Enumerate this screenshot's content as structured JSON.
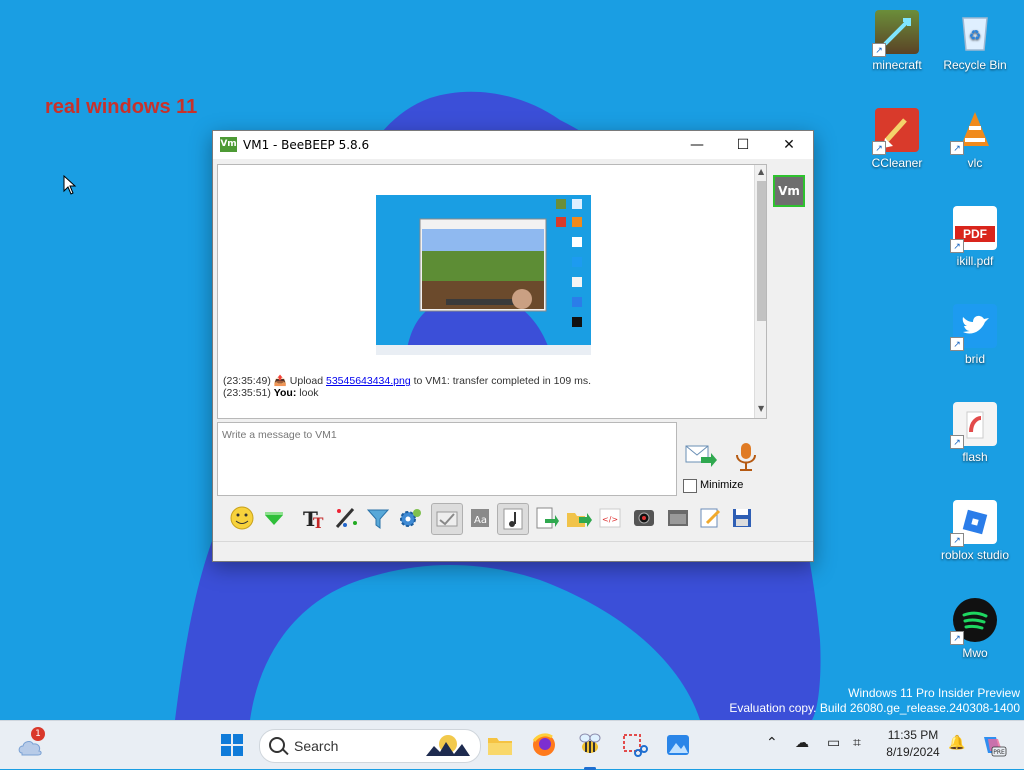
{
  "desktop": {
    "overlay_text": "real windows 11",
    "icons": [
      {
        "label": "minecraft"
      },
      {
        "label": "Recycle Bin"
      },
      {
        "label": "CCleaner"
      },
      {
        "label": "vlc"
      },
      {
        "label": "ikill.pdf",
        "badge": "PDF"
      },
      {
        "label": "brid"
      },
      {
        "label": "flash"
      },
      {
        "label": "roblox studio"
      },
      {
        "label": "Mwo"
      }
    ],
    "watermark": {
      "line1": "Windows 11 Pro Insider Preview",
      "line2": "Evaluation copy. Build 26080.ge_release.240308-1400"
    }
  },
  "window": {
    "title": "VM1 - BeeBEEP 5.8.6",
    "app_icon_text": "Vm",
    "controls": {
      "minimize": "—",
      "maximize": "☐",
      "close": "✕"
    },
    "messages": [
      {
        "time": "(23:35:49)",
        "prefix": "Upload",
        "link": "53545643434.png",
        "suffix": "to VM1: transfer completed in 109 ms."
      },
      {
        "time": "(23:35:51)",
        "sender": "You:",
        "text": "look"
      }
    ],
    "input_placeholder": "Write a message to VM1",
    "minimize_label": "Minimize",
    "user_avatar": "Vm"
  },
  "taskbar": {
    "weather_badge": "1",
    "search_label": "Search",
    "time": "11:35 PM",
    "date": "8/19/2024"
  },
  "colors": {
    "wallpaper": "#1a9ee3",
    "blob": "#3b4fd8",
    "beebeep_green": "#4d9a35"
  }
}
